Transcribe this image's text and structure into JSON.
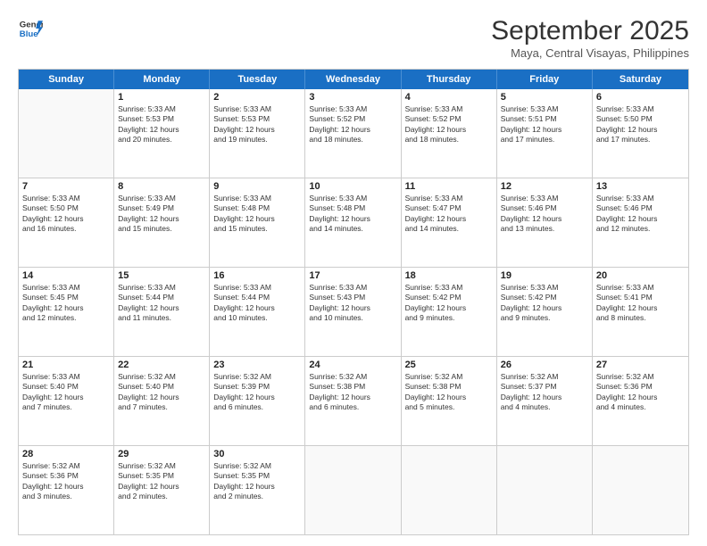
{
  "header": {
    "logo_line1": "General",
    "logo_line2": "Blue",
    "month": "September 2025",
    "location": "Maya, Central Visayas, Philippines"
  },
  "days_of_week": [
    "Sunday",
    "Monday",
    "Tuesday",
    "Wednesday",
    "Thursday",
    "Friday",
    "Saturday"
  ],
  "weeks": [
    [
      {
        "day": "",
        "text": ""
      },
      {
        "day": "1",
        "text": "Sunrise: 5:33 AM\nSunset: 5:53 PM\nDaylight: 12 hours\nand 20 minutes."
      },
      {
        "day": "2",
        "text": "Sunrise: 5:33 AM\nSunset: 5:53 PM\nDaylight: 12 hours\nand 19 minutes."
      },
      {
        "day": "3",
        "text": "Sunrise: 5:33 AM\nSunset: 5:52 PM\nDaylight: 12 hours\nand 18 minutes."
      },
      {
        "day": "4",
        "text": "Sunrise: 5:33 AM\nSunset: 5:52 PM\nDaylight: 12 hours\nand 18 minutes."
      },
      {
        "day": "5",
        "text": "Sunrise: 5:33 AM\nSunset: 5:51 PM\nDaylight: 12 hours\nand 17 minutes."
      },
      {
        "day": "6",
        "text": "Sunrise: 5:33 AM\nSunset: 5:50 PM\nDaylight: 12 hours\nand 17 minutes."
      }
    ],
    [
      {
        "day": "7",
        "text": "Sunrise: 5:33 AM\nSunset: 5:50 PM\nDaylight: 12 hours\nand 16 minutes."
      },
      {
        "day": "8",
        "text": "Sunrise: 5:33 AM\nSunset: 5:49 PM\nDaylight: 12 hours\nand 15 minutes."
      },
      {
        "day": "9",
        "text": "Sunrise: 5:33 AM\nSunset: 5:48 PM\nDaylight: 12 hours\nand 15 minutes."
      },
      {
        "day": "10",
        "text": "Sunrise: 5:33 AM\nSunset: 5:48 PM\nDaylight: 12 hours\nand 14 minutes."
      },
      {
        "day": "11",
        "text": "Sunrise: 5:33 AM\nSunset: 5:47 PM\nDaylight: 12 hours\nand 14 minutes."
      },
      {
        "day": "12",
        "text": "Sunrise: 5:33 AM\nSunset: 5:46 PM\nDaylight: 12 hours\nand 13 minutes."
      },
      {
        "day": "13",
        "text": "Sunrise: 5:33 AM\nSunset: 5:46 PM\nDaylight: 12 hours\nand 12 minutes."
      }
    ],
    [
      {
        "day": "14",
        "text": "Sunrise: 5:33 AM\nSunset: 5:45 PM\nDaylight: 12 hours\nand 12 minutes."
      },
      {
        "day": "15",
        "text": "Sunrise: 5:33 AM\nSunset: 5:44 PM\nDaylight: 12 hours\nand 11 minutes."
      },
      {
        "day": "16",
        "text": "Sunrise: 5:33 AM\nSunset: 5:44 PM\nDaylight: 12 hours\nand 10 minutes."
      },
      {
        "day": "17",
        "text": "Sunrise: 5:33 AM\nSunset: 5:43 PM\nDaylight: 12 hours\nand 10 minutes."
      },
      {
        "day": "18",
        "text": "Sunrise: 5:33 AM\nSunset: 5:42 PM\nDaylight: 12 hours\nand 9 minutes."
      },
      {
        "day": "19",
        "text": "Sunrise: 5:33 AM\nSunset: 5:42 PM\nDaylight: 12 hours\nand 9 minutes."
      },
      {
        "day": "20",
        "text": "Sunrise: 5:33 AM\nSunset: 5:41 PM\nDaylight: 12 hours\nand 8 minutes."
      }
    ],
    [
      {
        "day": "21",
        "text": "Sunrise: 5:33 AM\nSunset: 5:40 PM\nDaylight: 12 hours\nand 7 minutes."
      },
      {
        "day": "22",
        "text": "Sunrise: 5:32 AM\nSunset: 5:40 PM\nDaylight: 12 hours\nand 7 minutes."
      },
      {
        "day": "23",
        "text": "Sunrise: 5:32 AM\nSunset: 5:39 PM\nDaylight: 12 hours\nand 6 minutes."
      },
      {
        "day": "24",
        "text": "Sunrise: 5:32 AM\nSunset: 5:38 PM\nDaylight: 12 hours\nand 6 minutes."
      },
      {
        "day": "25",
        "text": "Sunrise: 5:32 AM\nSunset: 5:38 PM\nDaylight: 12 hours\nand 5 minutes."
      },
      {
        "day": "26",
        "text": "Sunrise: 5:32 AM\nSunset: 5:37 PM\nDaylight: 12 hours\nand 4 minutes."
      },
      {
        "day": "27",
        "text": "Sunrise: 5:32 AM\nSunset: 5:36 PM\nDaylight: 12 hours\nand 4 minutes."
      }
    ],
    [
      {
        "day": "28",
        "text": "Sunrise: 5:32 AM\nSunset: 5:36 PM\nDaylight: 12 hours\nand 3 minutes."
      },
      {
        "day": "29",
        "text": "Sunrise: 5:32 AM\nSunset: 5:35 PM\nDaylight: 12 hours\nand 2 minutes."
      },
      {
        "day": "30",
        "text": "Sunrise: 5:32 AM\nSunset: 5:35 PM\nDaylight: 12 hours\nand 2 minutes."
      },
      {
        "day": "",
        "text": ""
      },
      {
        "day": "",
        "text": ""
      },
      {
        "day": "",
        "text": ""
      },
      {
        "day": "",
        "text": ""
      }
    ]
  ]
}
